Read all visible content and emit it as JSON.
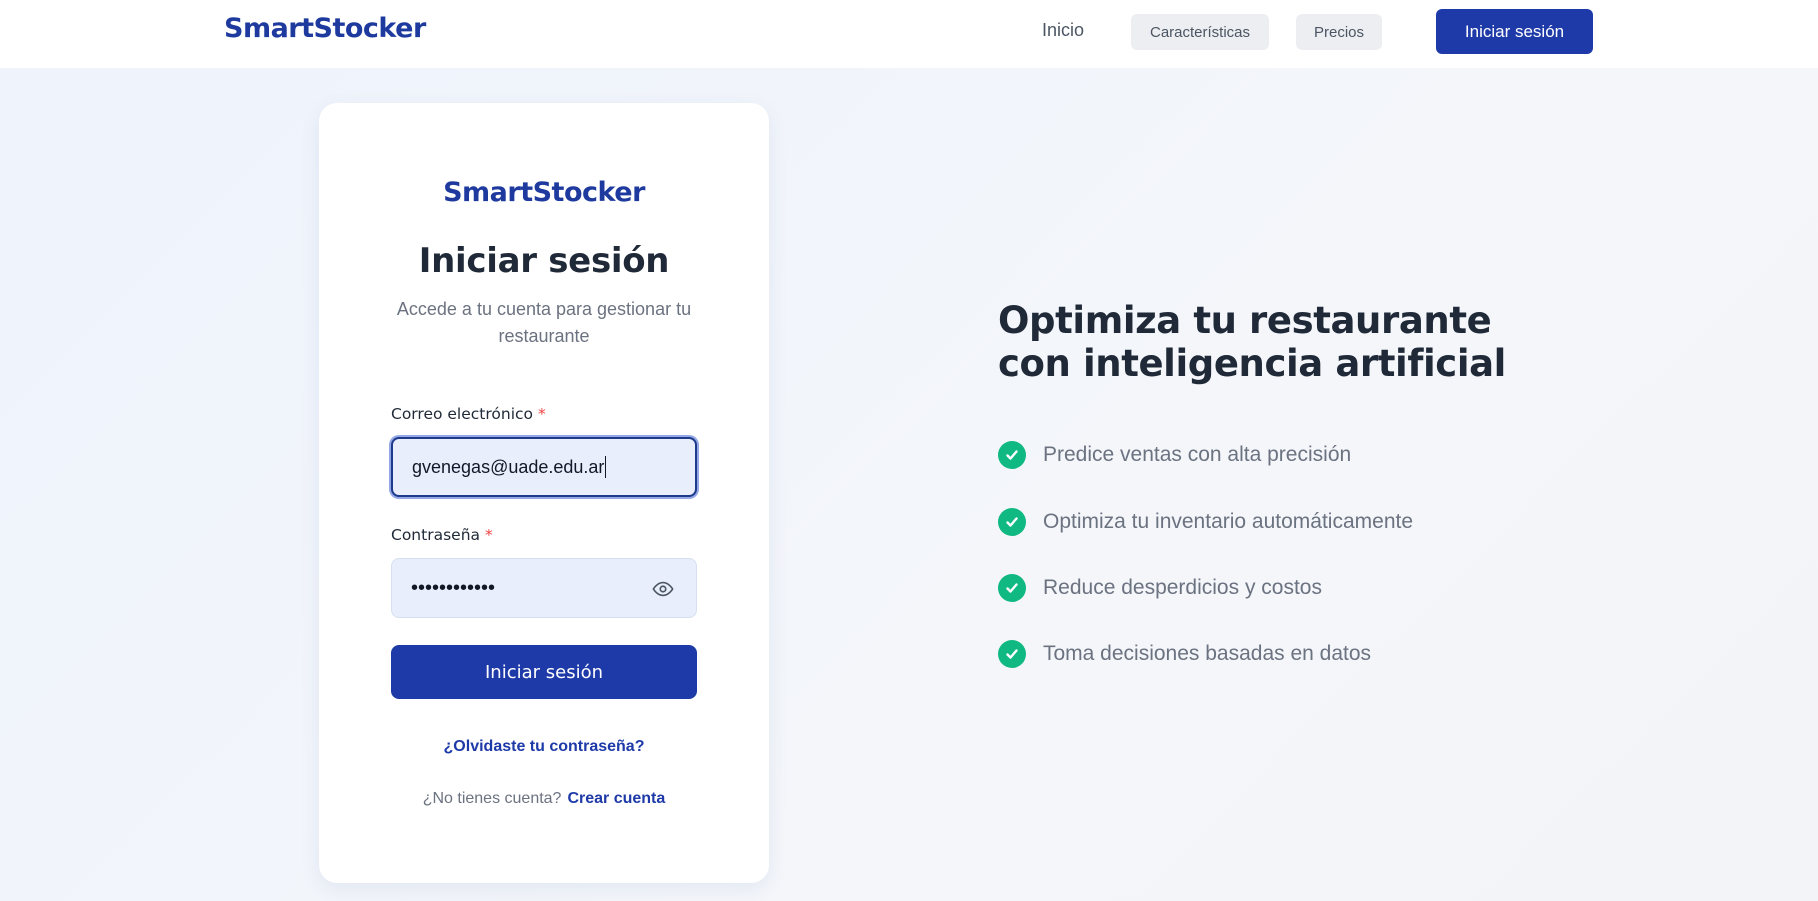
{
  "header": {
    "brand": "SmartStocker",
    "nav": {
      "inicio": "Inicio",
      "caracteristicas": "Características",
      "precios": "Precios"
    },
    "login_button": "Iniciar sesión"
  },
  "card": {
    "brand": "SmartStocker",
    "title": "Iniciar sesión",
    "subtitle": "Accede a tu cuenta para gestionar tu restaurante",
    "email": {
      "label": "Correo electrónico",
      "required_mark": "*",
      "value": "gvenegas@uade.edu.ar"
    },
    "password": {
      "label": "Contraseña",
      "required_mark": "*",
      "value": "••••••••••••"
    },
    "submit_label": "Iniciar sesión",
    "forgot_link": "¿Olvidaste tu contraseña?",
    "signup_prompt": "¿No tienes cuenta?",
    "signup_link": "Crear cuenta"
  },
  "hero": {
    "title": "Optimiza tu restaurante con inteligencia artificial",
    "features": [
      "Predice ventas con alta precisión",
      "Optimiza tu inventario automáticamente",
      "Reduce desperdicios y costos",
      "Toma decisiones basadas en datos"
    ]
  },
  "icons": {
    "check": "check-circle-icon",
    "eye": "eye-icon"
  },
  "colors": {
    "brand": "#1e3a9f",
    "primary": "#1e3aa8",
    "success": "#10b981",
    "required": "#ef4444"
  }
}
